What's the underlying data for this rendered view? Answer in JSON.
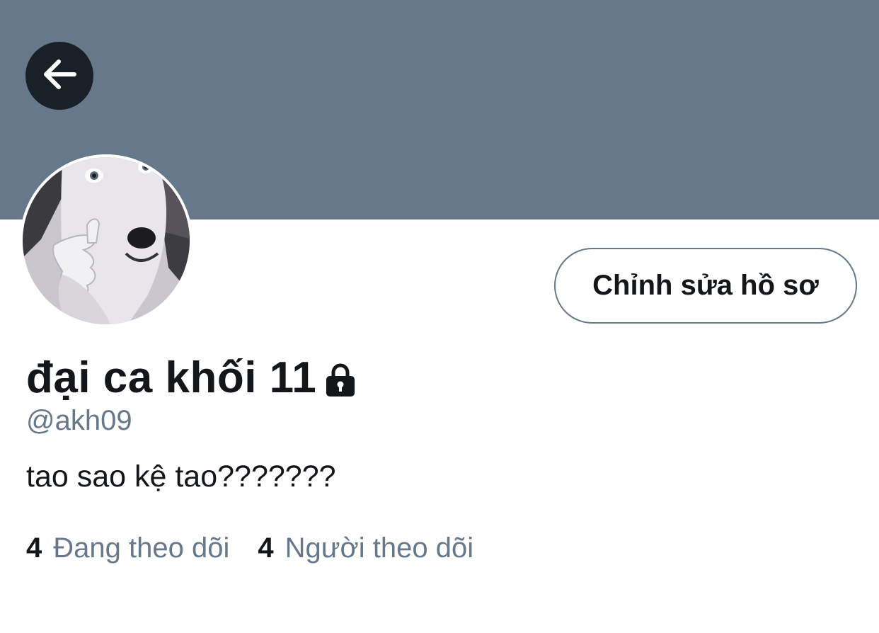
{
  "header": {
    "banner_color": "#66788a",
    "back_icon": "arrow-left-icon"
  },
  "profile": {
    "avatar_description": "husky-pointing-avatar",
    "edit_button_label": "Chỉnh sửa hồ sơ",
    "display_name": "đại ca khối 11",
    "protected_icon": "lock-icon",
    "handle": "@akh09",
    "bio": "tao sao kệ tao???????"
  },
  "stats": {
    "following_count": "4",
    "following_label": "Đang theo dõi",
    "followers_count": "4",
    "followers_label": "Người theo dõi"
  },
  "colors": {
    "text_primary": "#14171a",
    "text_secondary": "#66788a",
    "back_button_bg": "#1a2027"
  }
}
